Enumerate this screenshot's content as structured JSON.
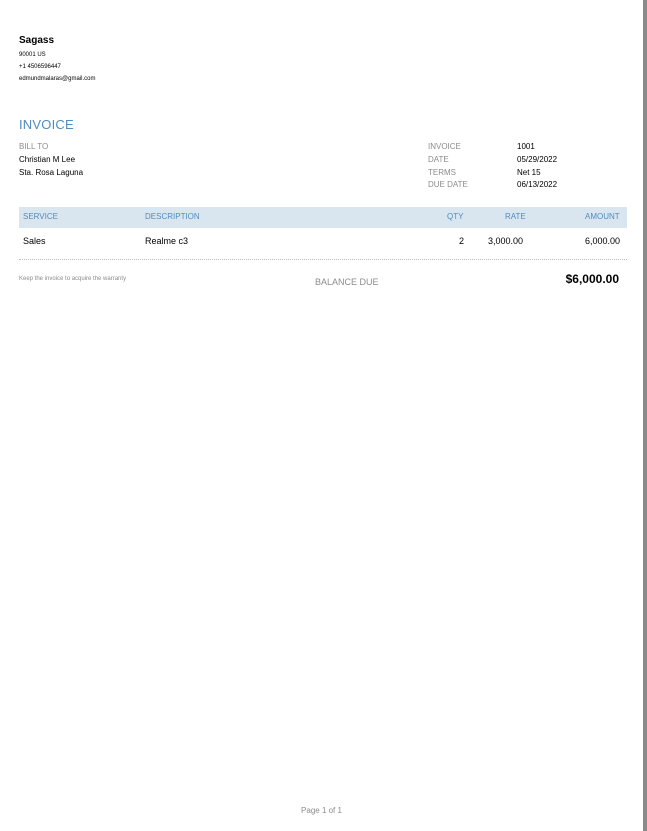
{
  "company": {
    "name": "Sagass",
    "postal": "90001 US",
    "phone": "+1 4506596447",
    "email": "edmundmalaras@gmail.com"
  },
  "invoice_title": "INVOICE",
  "bill_to": {
    "label": "BILL TO",
    "name": "Christian M Lee",
    "address": "Sta. Rosa Laguna"
  },
  "meta": {
    "invoice_label": "INVOICE",
    "invoice_value": "1001",
    "date_label": "DATE",
    "date_value": "05/29/2022",
    "terms_label": "TERMS",
    "terms_value": "Net 15",
    "due_label": "DUE DATE",
    "due_value": "06/13/2022"
  },
  "table": {
    "headers": {
      "service": "SERVICE",
      "description": "DESCRIPTION",
      "qty": "QTY",
      "rate": "RATE",
      "amount": "AMOUNT"
    },
    "rows": [
      {
        "service": "Sales",
        "description": "Realme c3",
        "qty": "2",
        "rate": "3,000.00",
        "amount": "6,000.00"
      }
    ]
  },
  "footer": {
    "note": "Keep the invoice to acquire the warranty",
    "balance_label": "BALANCE DUE",
    "balance_amount": "$6,000.00"
  },
  "page_indicator": "Page 1 of 1",
  "colors": {
    "accent": "#4f8cc0",
    "header_bg": "#dae6ef",
    "muted": "#8c8c8c"
  }
}
